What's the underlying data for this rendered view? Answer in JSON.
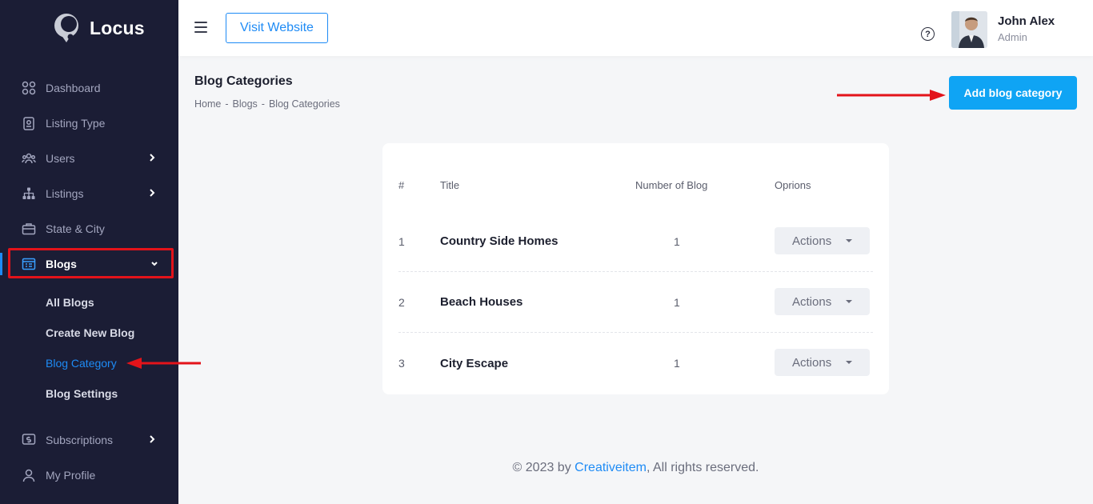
{
  "brand": {
    "name": "Locus"
  },
  "sidebar": {
    "items": [
      {
        "label": "Dashboard",
        "icon": "dashboard-icon"
      },
      {
        "label": "Listing Type",
        "icon": "listing-type-icon"
      },
      {
        "label": "Users",
        "icon": "users-icon"
      },
      {
        "label": "Listings",
        "icon": "listings-icon"
      },
      {
        "label": "State & City",
        "icon": "briefcase-icon"
      },
      {
        "label": "Blogs",
        "icon": "blogs-icon"
      },
      {
        "label": "Subscriptions",
        "icon": "subscriptions-icon"
      },
      {
        "label": "My Profile",
        "icon": "profile-icon"
      }
    ],
    "blog_sub_items": [
      {
        "label": "All Blogs"
      },
      {
        "label": "Create New Blog"
      },
      {
        "label": "Blog Category"
      },
      {
        "label": "Blog Settings"
      }
    ]
  },
  "header": {
    "visit_label": "Visit Website",
    "help_glyph": "?",
    "user_name": "John Alex",
    "user_role": "Admin"
  },
  "page": {
    "title": "Blog Categories",
    "breadcrumb": [
      "Home",
      "Blogs",
      "Blog Categories"
    ],
    "breadcrumb_sep": "-",
    "add_button": "Add blog category"
  },
  "table": {
    "headers": [
      "#",
      "Title",
      "Number of Blog",
      "Oprions"
    ],
    "rows": [
      {
        "num": "1",
        "title": "Country Side Homes",
        "count": "1",
        "action": "Actions"
      },
      {
        "num": "2",
        "title": "Beach Houses",
        "count": "1",
        "action": "Actions"
      },
      {
        "num": "3",
        "title": "City Escape",
        "count": "1",
        "action": "Actions"
      }
    ]
  },
  "footer": {
    "prefix": "© 2023 by ",
    "link": "Creativeitem",
    "suffix": ", All rights reserved."
  },
  "colors": {
    "sidebar_bg": "#1b1d35",
    "accent": "#1e8bf5",
    "primary_button": "#0fa4f4",
    "annotation": "#e3131a"
  }
}
